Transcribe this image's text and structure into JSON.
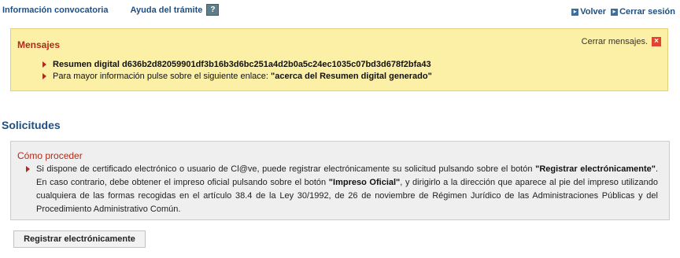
{
  "topnav": {
    "info_link": "Información convocatoria",
    "help_link": "Ayuda del trámite",
    "help_icon": "?",
    "back_link": "Volver",
    "logout_link": "Cerrar sesión"
  },
  "messages": {
    "title": "Mensajes",
    "close_label": "Cerrar mensajes.",
    "items": [
      {
        "text": "Resumen digital d636b2d82059901df3b16b3d6bc251a4d2b0a5c24ec1035c07bd3d678f2bfa43"
      },
      {
        "prefix": "Para mayor información pulse sobre el siguiente enlace: ",
        "link": "\"acerca del Resumen digital generado\""
      }
    ]
  },
  "section_title": "Solicitudes",
  "how_to": {
    "title": "Cómo proceder",
    "text1": "Si dispone de certificado electrónico o usuario de Cl@ve, puede registrar electrónicamente su solicitud pulsando sobre el botón ",
    "bold1": "\"Registrar electrónicamente\"",
    "text2": ". En caso contrario, debe obtener el impreso oficial pulsando sobre el botón ",
    "bold2": "\"Impreso Oficial\"",
    "text3": ", y dirigirlo a la dirección que aparece al pie del impreso utilizando cualquiera de las formas recogidas en el artículo 38.4 de la Ley 30/1992, de 26 de noviembre de Régimen Jurídico de las Administraciones Públicas y del Procedimiento Administrativo Común."
  },
  "register_button": "Registrar electrónicamente",
  "colors": {
    "link": "#1f4f82",
    "accent_red": "#b12a1a",
    "message_bg": "#fcf0a6"
  }
}
